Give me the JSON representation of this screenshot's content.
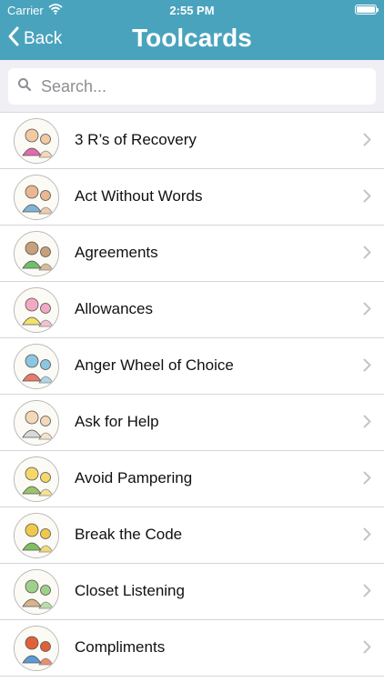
{
  "status": {
    "carrier": "Carrier",
    "time": "2:55 PM"
  },
  "nav": {
    "back_label": "Back",
    "title": "Toolcards"
  },
  "search": {
    "placeholder": "Search..."
  },
  "items": [
    {
      "label": "3 R’s of Recovery",
      "c1": "#f2c9a0",
      "c2": "#e06ab0"
    },
    {
      "label": "Act Without Words",
      "c1": "#e9b790",
      "c2": "#7fb3d8"
    },
    {
      "label": "Agreements",
      "c1": "#c8a07a",
      "c2": "#6fbf6a"
    },
    {
      "label": "Allowances",
      "c1": "#f3a9c4",
      "c2": "#f2e26b"
    },
    {
      "label": "Anger Wheel of Choice",
      "c1": "#8cc6e0",
      "c2": "#e87a6a"
    },
    {
      "label": "Ask for Help",
      "c1": "#f4d9b8",
      "c2": "#d9d9d9"
    },
    {
      "label": "Avoid Pampering",
      "c1": "#f5d76a",
      "c2": "#9ac46a"
    },
    {
      "label": "Break the Code",
      "c1": "#f1c94a",
      "c2": "#7fbf60"
    },
    {
      "label": "Closet Listening",
      "c1": "#9fd08a",
      "c2": "#d8b48c"
    },
    {
      "label": "Compliments",
      "c1": "#e0603a",
      "c2": "#5a9ad8"
    }
  ]
}
